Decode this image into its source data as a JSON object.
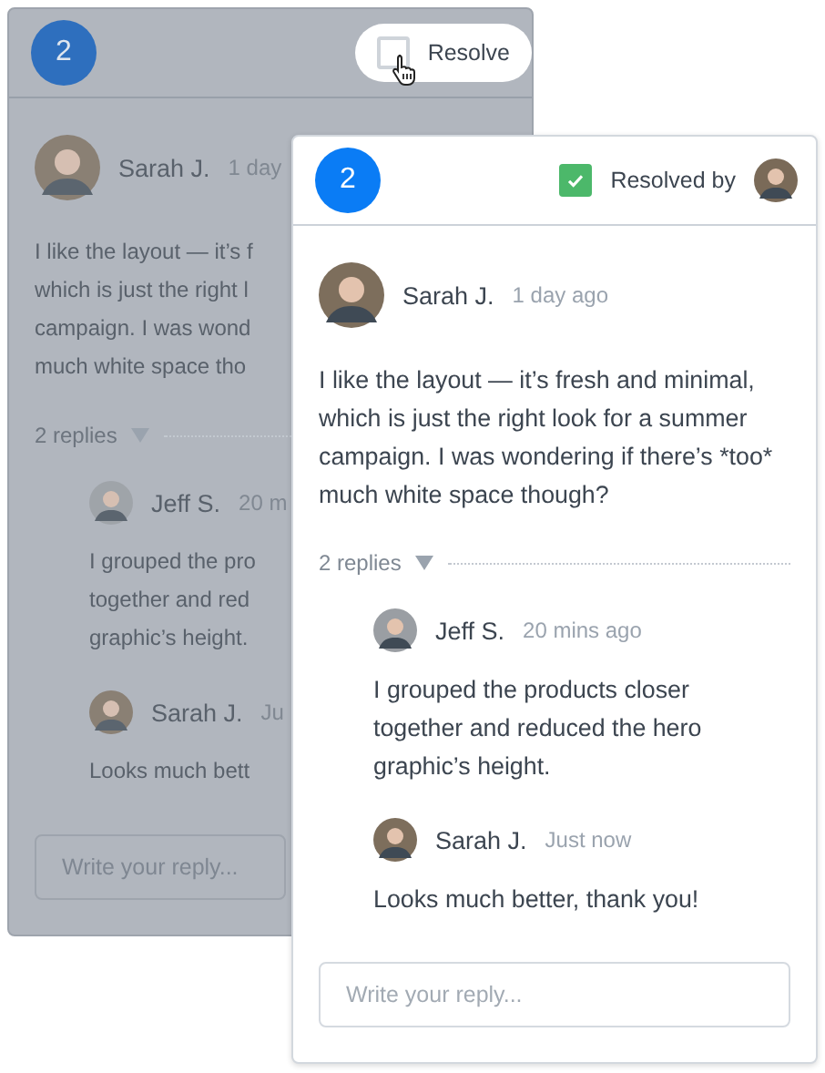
{
  "threads": [
    {
      "dimmed": true,
      "number": "2",
      "resolve": {
        "label": "Resolve",
        "checked": false,
        "hovered": true
      },
      "comment": {
        "author": "Sarah J.",
        "time": "1 day",
        "lines": [
          "I like the layout — it’s f",
          "which is just the right l",
          "campaign. I was wond",
          "much white space tho"
        ]
      },
      "replies_label": "2 replies",
      "replies": [
        {
          "author": "Jeff S.",
          "time": "20 m",
          "lines": [
            "I grouped the pro",
            "together and red",
            "graphic’s height."
          ]
        },
        {
          "author": "Sarah J.",
          "time": "Ju",
          "lines": [
            "Looks much bett"
          ]
        }
      ],
      "reply_field": {
        "placeholder": "Write your reply..."
      }
    },
    {
      "dimmed": false,
      "number": "2",
      "resolve": {
        "label": "Resolved by",
        "checked": true,
        "hovered": false
      },
      "comment": {
        "author": "Sarah J.",
        "time": "1 day ago",
        "lines": [
          "I like the layout — it’s fresh and minimal,",
          "which is just the right look for a summer",
          "campaign. I was wondering if there’s *too*",
          "much white space though?"
        ]
      },
      "replies_label": "2 replies",
      "replies": [
        {
          "author": "Jeff S.",
          "time": "20 mins ago",
          "lines": [
            "I grouped the products closer",
            "together and reduced the hero",
            "graphic’s height."
          ]
        },
        {
          "author": "Sarah J.",
          "time": "Just now",
          "lines": [
            "Looks much better, thank you!"
          ]
        }
      ],
      "reply_field": {
        "placeholder": "Write your reply..."
      }
    }
  ]
}
